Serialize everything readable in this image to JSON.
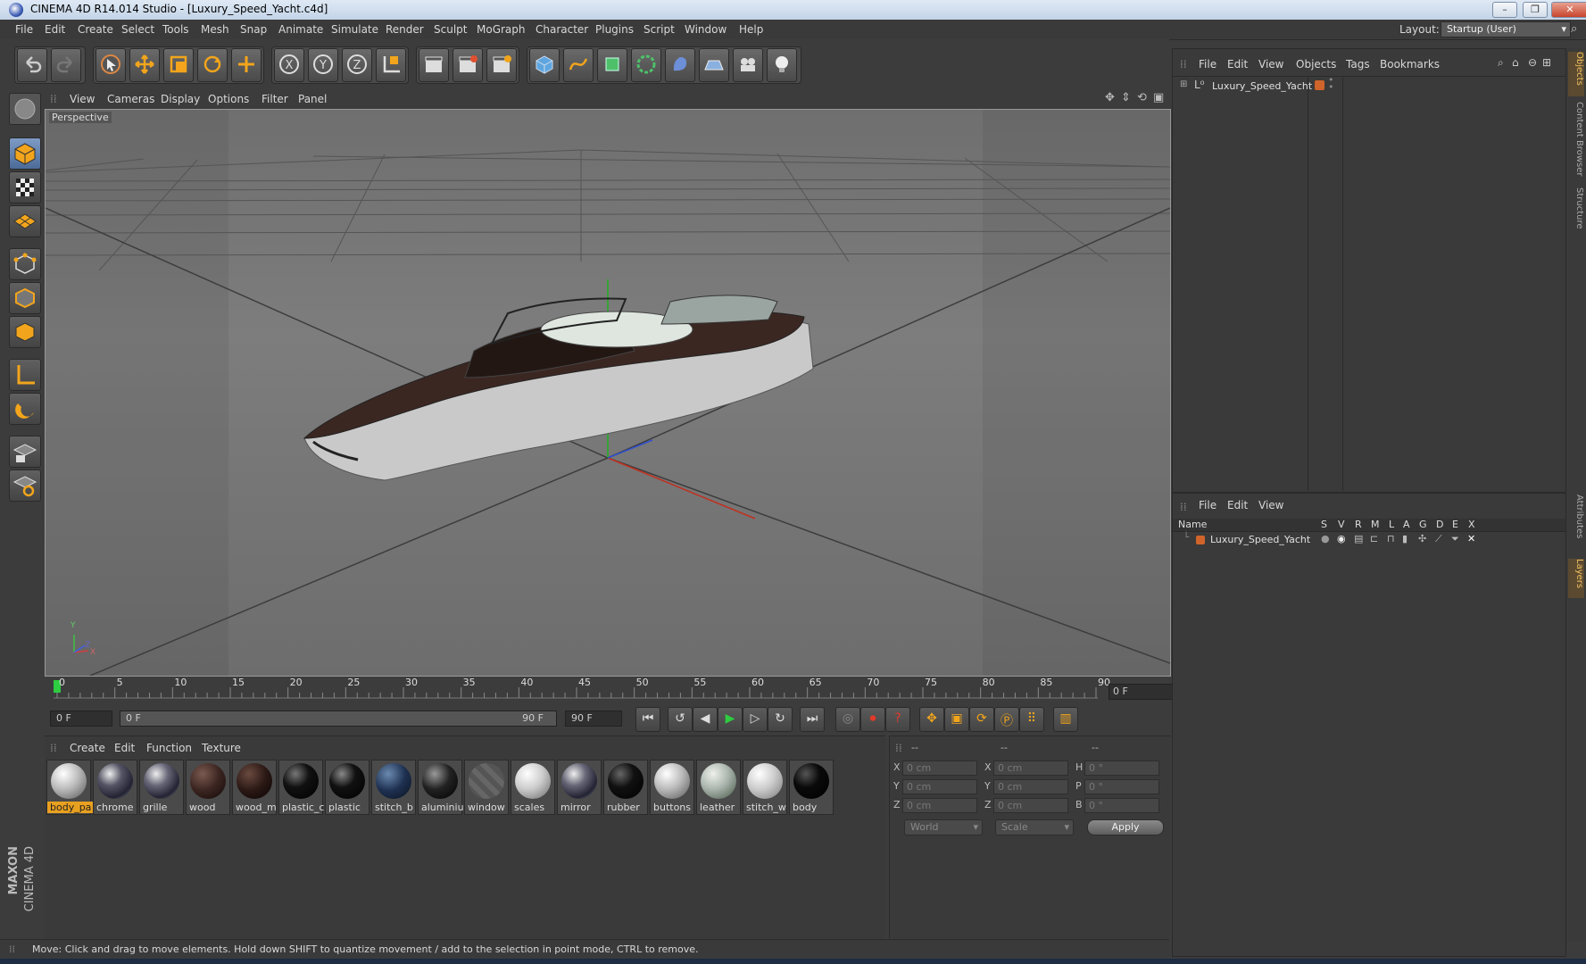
{
  "window": {
    "title": "CINEMA 4D R14.014 Studio - [Luxury_Speed_Yacht.c4d]",
    "min": "–",
    "max": "❐",
    "close": "✕"
  },
  "menu": [
    "File",
    "Edit",
    "Create",
    "Select",
    "Tools",
    "Mesh",
    "Snap",
    "Animate",
    "Simulate",
    "Render",
    "Sculpt",
    "MoGraph",
    "Character",
    "Plugins",
    "Script",
    "Window",
    "Help"
  ],
  "layout": {
    "label": "Layout:",
    "value": "Startup (User)"
  },
  "viewport": {
    "menu": [
      "View",
      "Cameras",
      "Display",
      "Options",
      "Filter",
      "Panel"
    ],
    "label": "Perspective",
    "axes": {
      "y": "Y",
      "x": "X",
      "z": "Z"
    }
  },
  "timeline": {
    "ticks": [
      "0",
      "5",
      "10",
      "15",
      "20",
      "25",
      "30",
      "35",
      "40",
      "45",
      "50",
      "55",
      "60",
      "65",
      "70",
      "75",
      "80",
      "85",
      "90"
    ],
    "current_frame": "0 F",
    "start_field": "0 F",
    "range_start": "0 F",
    "range_end": "90 F",
    "end_field": "90 F"
  },
  "materials": {
    "menu": [
      "Create",
      "Edit",
      "Function",
      "Texture"
    ],
    "items": [
      {
        "name": "body_pa",
        "selected": true
      },
      {
        "name": "chrome"
      },
      {
        "name": "grille"
      },
      {
        "name": "wood"
      },
      {
        "name": "wood_m"
      },
      {
        "name": "plastic_c"
      },
      {
        "name": "plastic"
      },
      {
        "name": "stitch_b"
      },
      {
        "name": "aluminiu"
      },
      {
        "name": "window"
      },
      {
        "name": "scales"
      },
      {
        "name": "mirror"
      },
      {
        "name": "rubber"
      },
      {
        "name": "buttons"
      },
      {
        "name": "leather"
      },
      {
        "name": "stitch_w"
      },
      {
        "name": "body"
      }
    ]
  },
  "coordinates": {
    "headers": [
      "--",
      "--",
      "--"
    ],
    "rows": [
      {
        "a": "X",
        "av": "0 cm",
        "b": "X",
        "bv": "0 cm",
        "c": "H",
        "cv": "0 °"
      },
      {
        "a": "Y",
        "av": "0 cm",
        "b": "Y",
        "bv": "0 cm",
        "c": "P",
        "cv": "0 °"
      },
      {
        "a": "Z",
        "av": "0 cm",
        "b": "Z",
        "bv": "0 cm",
        "c": "B",
        "cv": "0 °"
      }
    ],
    "world": "World",
    "scale": "Scale",
    "apply": "Apply"
  },
  "status": "Move: Click and drag to move elements. Hold down SHIFT to quantize movement / add to the selection in point mode, CTRL to remove.",
  "objects": {
    "menu": [
      "File",
      "Edit",
      "View",
      "Objects",
      "Tags",
      "Bookmarks"
    ],
    "item": "Luxury_Speed_Yacht"
  },
  "layers": {
    "menu": [
      "File",
      "Edit",
      "View"
    ],
    "columns": [
      "Name",
      "S",
      "V",
      "R",
      "M",
      "L",
      "A",
      "G",
      "D",
      "E",
      "X"
    ],
    "item": "Luxury_Speed_Yacht"
  },
  "side_tabs": [
    "Objects",
    "Content Browser",
    "Structure",
    "Attributes",
    "Layers"
  ],
  "brand": {
    "maxon": "MAXON",
    "product": "CINEMA 4D"
  },
  "colors": {
    "accent": "#e8a020",
    "selection": "#7d9bc4",
    "layer": "#d0642a"
  }
}
